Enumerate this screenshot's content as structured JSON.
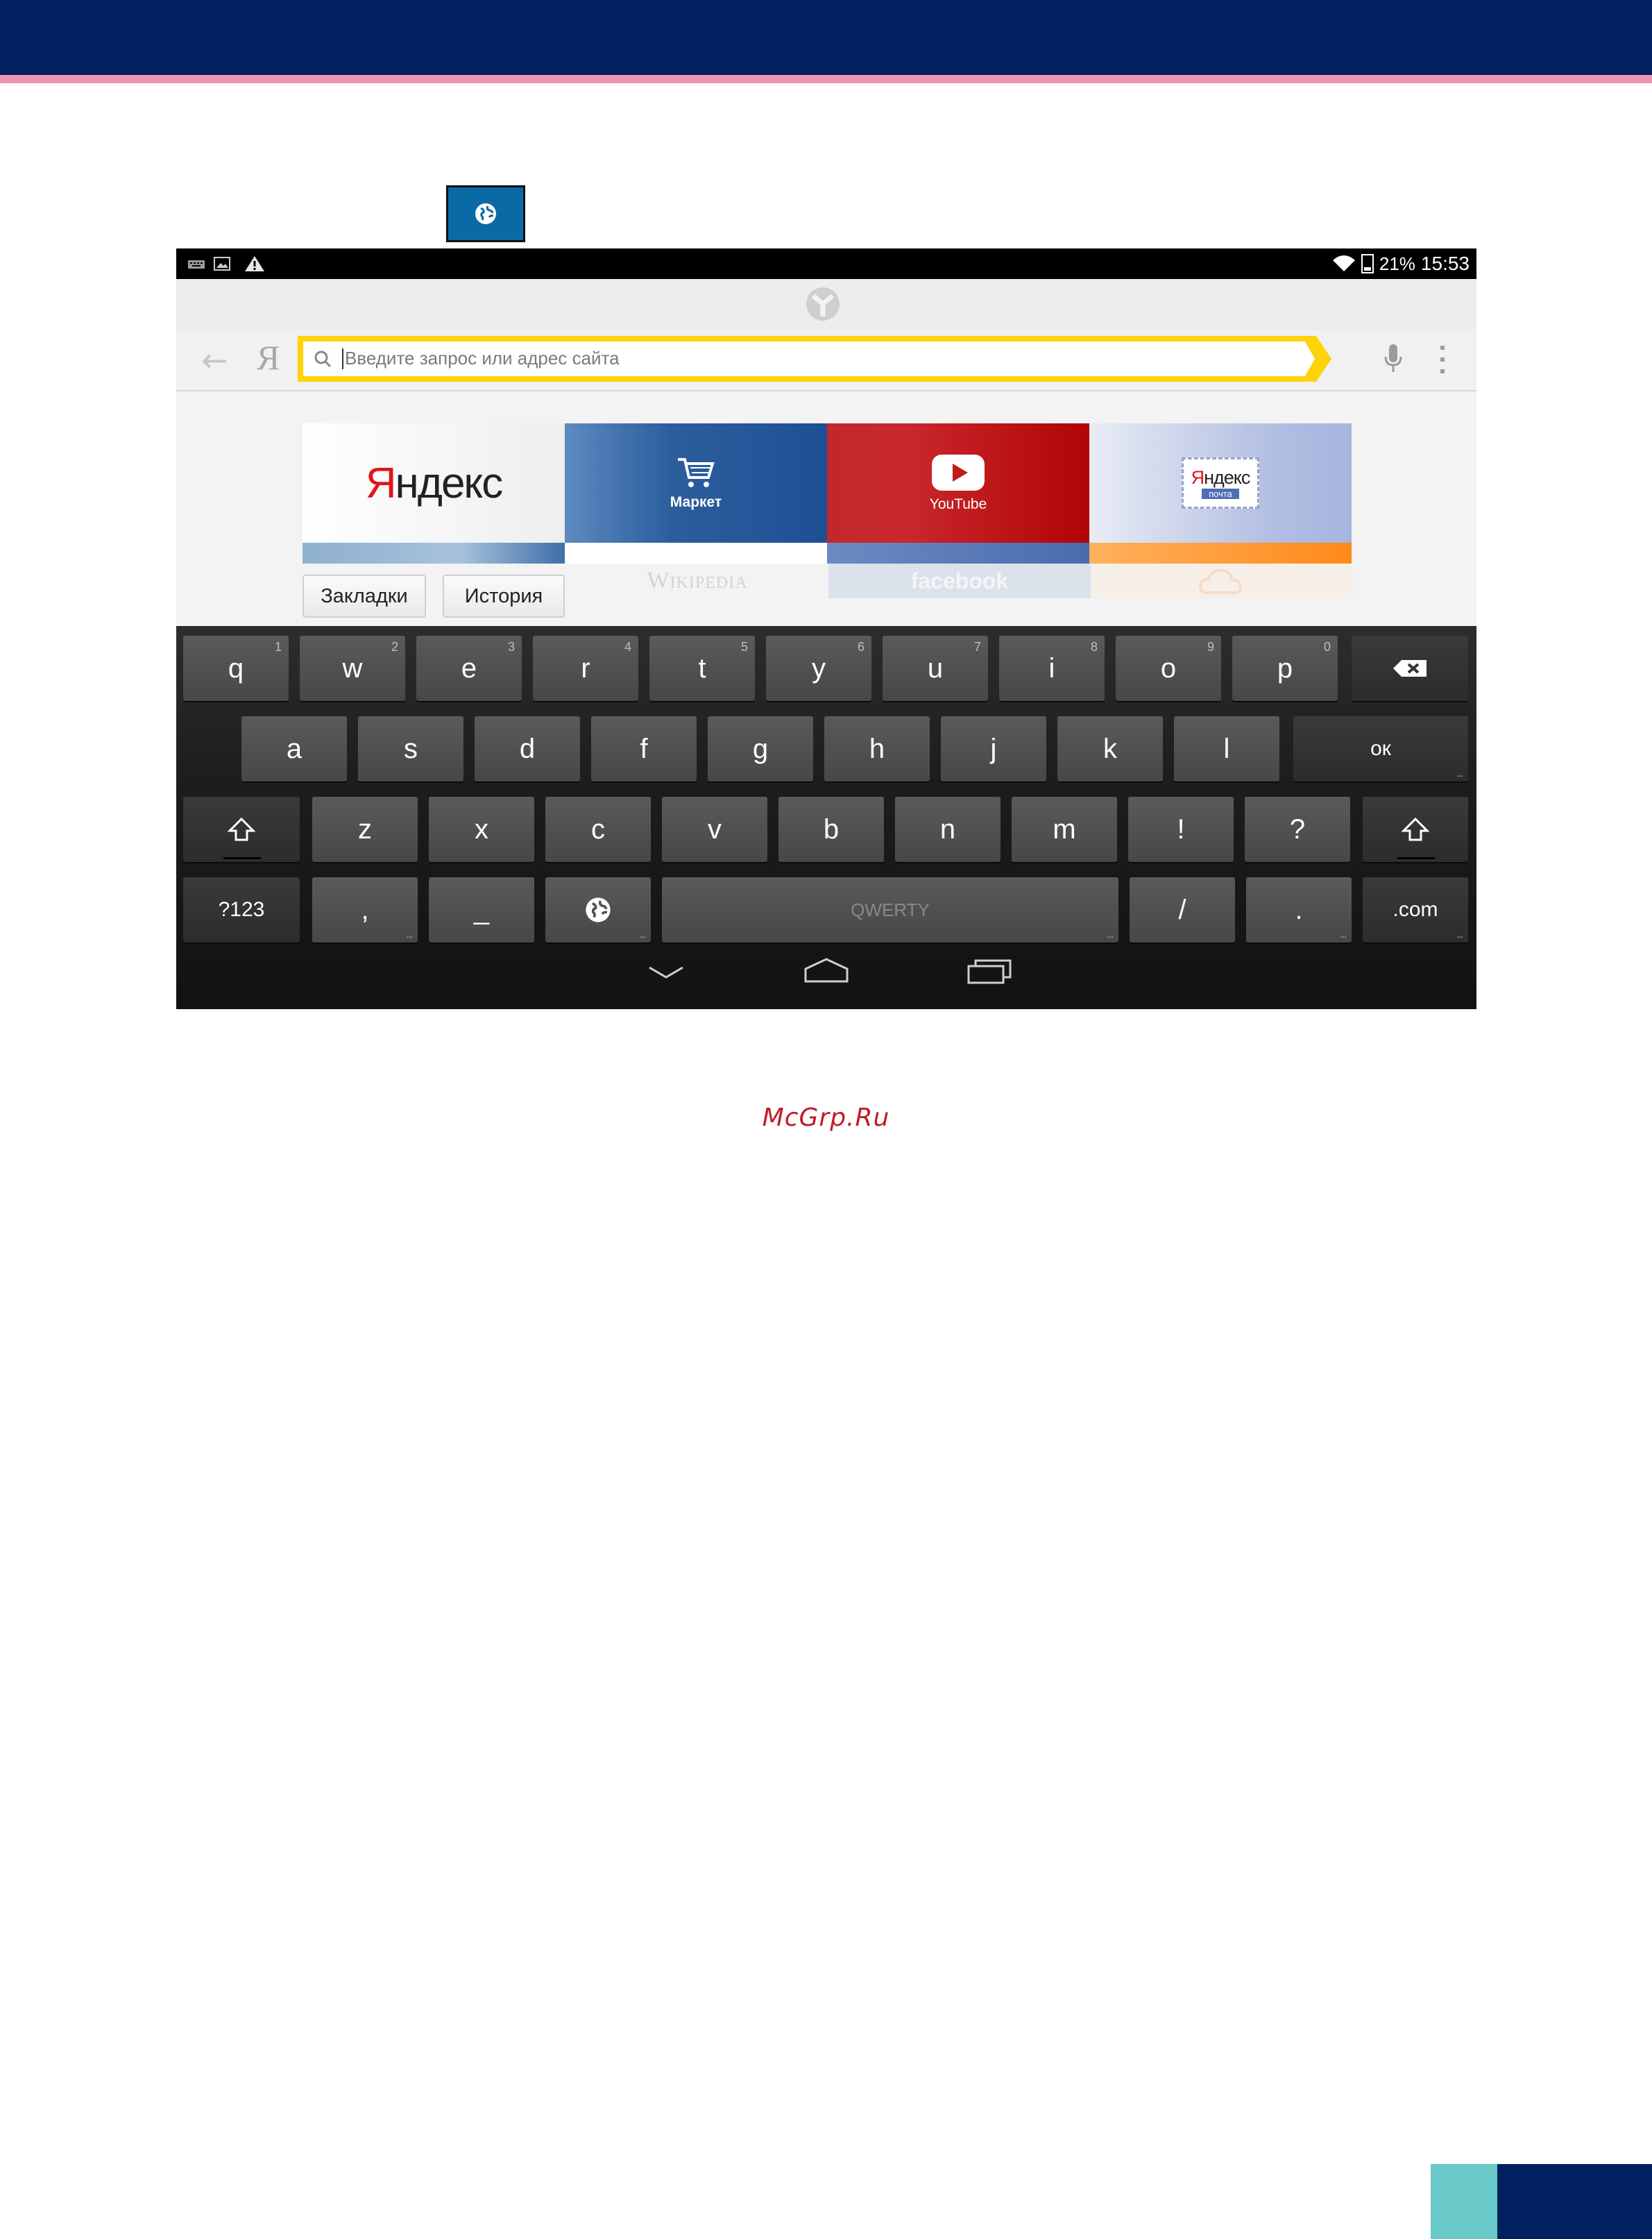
{
  "status_bar": {
    "battery": "21%",
    "time": "15:53"
  },
  "address_bar": {
    "placeholder": "Введите запрос или адрес сайта",
    "search_letter": "Я"
  },
  "tiles": [
    {
      "name": "yandex",
      "logo": "Яндекс"
    },
    {
      "name": "market",
      "caption": "Маркет"
    },
    {
      "name": "youtube",
      "caption": "YouTube"
    },
    {
      "name": "yandex-mail",
      "logo": "Яндекс",
      "sub": "почта"
    }
  ],
  "ghost_tiles": {
    "wikipedia": "Wikipedia",
    "facebook": "facebook"
  },
  "buttons": {
    "bookmarks": "Закладки",
    "history": "История"
  },
  "keyboard": {
    "row1": [
      {
        "label": "q",
        "hint": "1"
      },
      {
        "label": "w",
        "hint": "2"
      },
      {
        "label": "e",
        "hint": "3"
      },
      {
        "label": "r",
        "hint": "4"
      },
      {
        "label": "t",
        "hint": "5"
      },
      {
        "label": "y",
        "hint": "6"
      },
      {
        "label": "u",
        "hint": "7"
      },
      {
        "label": "i",
        "hint": "8"
      },
      {
        "label": "o",
        "hint": "9"
      },
      {
        "label": "p",
        "hint": "0"
      }
    ],
    "row2": [
      "a",
      "s",
      "d",
      "f",
      "g",
      "h",
      "j",
      "k",
      "l"
    ],
    "row3": [
      "z",
      "x",
      "c",
      "v",
      "b",
      "n",
      "m",
      "!",
      "?"
    ],
    "ok": "ок",
    "symbols": "?123",
    "comma": ",",
    "underscore": "_",
    "space": "QWERTY",
    "slash": "/",
    "period": ".",
    "dotcom": ".com"
  },
  "watermark": "McGrp.Ru",
  "colors": {
    "header_navy": "#00205f",
    "header_pink": "#ef94b4",
    "address_yellow": "#ffd20a",
    "corner_teal": "#6ac9c9",
    "watermark_red": "#c01c28"
  },
  "icons": [
    "globe-icon",
    "keyboard-notif-icon",
    "image-notif-icon",
    "warning-icon",
    "wifi-icon",
    "battery-icon",
    "yandex-browser-logo-icon",
    "back-arrow-icon",
    "search-icon",
    "microphone-icon",
    "menu-dots-icon",
    "cart-icon",
    "youtube-play-icon",
    "cloud-icon",
    "backspace-icon",
    "shift-icon",
    "nav-back-icon",
    "nav-home-icon",
    "nav-recents-icon"
  ]
}
